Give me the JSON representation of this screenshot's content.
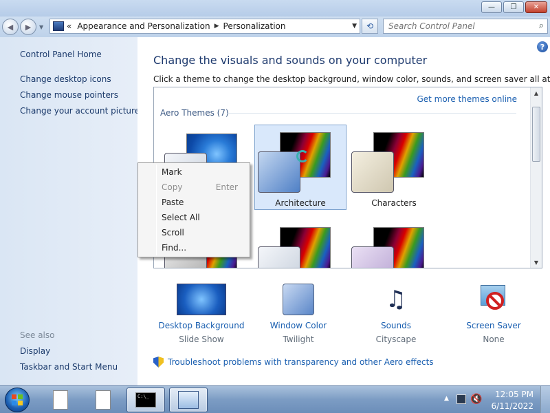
{
  "window": {
    "minimize_glyph": "—",
    "maximize_glyph": "❐",
    "close_glyph": "✕"
  },
  "nav": {
    "back_glyph": "◀",
    "forward_glyph": "▶",
    "breadcrumb_prefix": "«",
    "breadcrumb": [
      "Appearance and Personalization",
      "Personalization"
    ],
    "search_placeholder": "Search Control Panel"
  },
  "sidebar": {
    "home": "Control Panel Home",
    "links": [
      "Change desktop icons",
      "Change mouse pointers",
      "Change your account picture"
    ],
    "see_also_label": "See also",
    "see_also": [
      "Display",
      "Taskbar and Start Menu"
    ]
  },
  "main": {
    "help_glyph": "?",
    "heading": "Change the visuals and sounds on your computer",
    "subtext": "Click a theme to change the desktop background, window color, sounds, and screen saver all at once.",
    "get_more": "Get more themes online",
    "group_header": "Aero Themes (7)",
    "themes": [
      {
        "name": "",
        "selected": false
      },
      {
        "name": "Architecture",
        "selected": true
      },
      {
        "name": "Characters",
        "selected": false
      }
    ]
  },
  "quick_settings": [
    {
      "title": "Desktop Background",
      "value": "Slide Show",
      "icon": "desktop-background-icon"
    },
    {
      "title": "Window Color",
      "value": "Twilight",
      "icon": "window-color-icon"
    },
    {
      "title": "Sounds",
      "value": "Cityscape",
      "icon": "sounds-icon"
    },
    {
      "title": "Screen Saver",
      "value": "None",
      "icon": "screen-saver-icon"
    }
  ],
  "troubleshoot": "Troubleshoot problems with transparency and other Aero effects",
  "context_menu": {
    "items": [
      {
        "label": "Mark",
        "accel": "",
        "disabled": false
      },
      {
        "label": "Copy",
        "accel": "Enter",
        "disabled": true
      },
      {
        "label": "Paste",
        "accel": "",
        "disabled": false
      },
      {
        "label": "Select All",
        "accel": "",
        "disabled": false
      },
      {
        "label": "Scroll",
        "accel": "",
        "disabled": false
      },
      {
        "label": "Find...",
        "accel": "",
        "disabled": false
      }
    ]
  },
  "taskbar": {
    "cmd_text": "C:\\_",
    "time": "12:05 PM",
    "date": "6/11/2022"
  }
}
